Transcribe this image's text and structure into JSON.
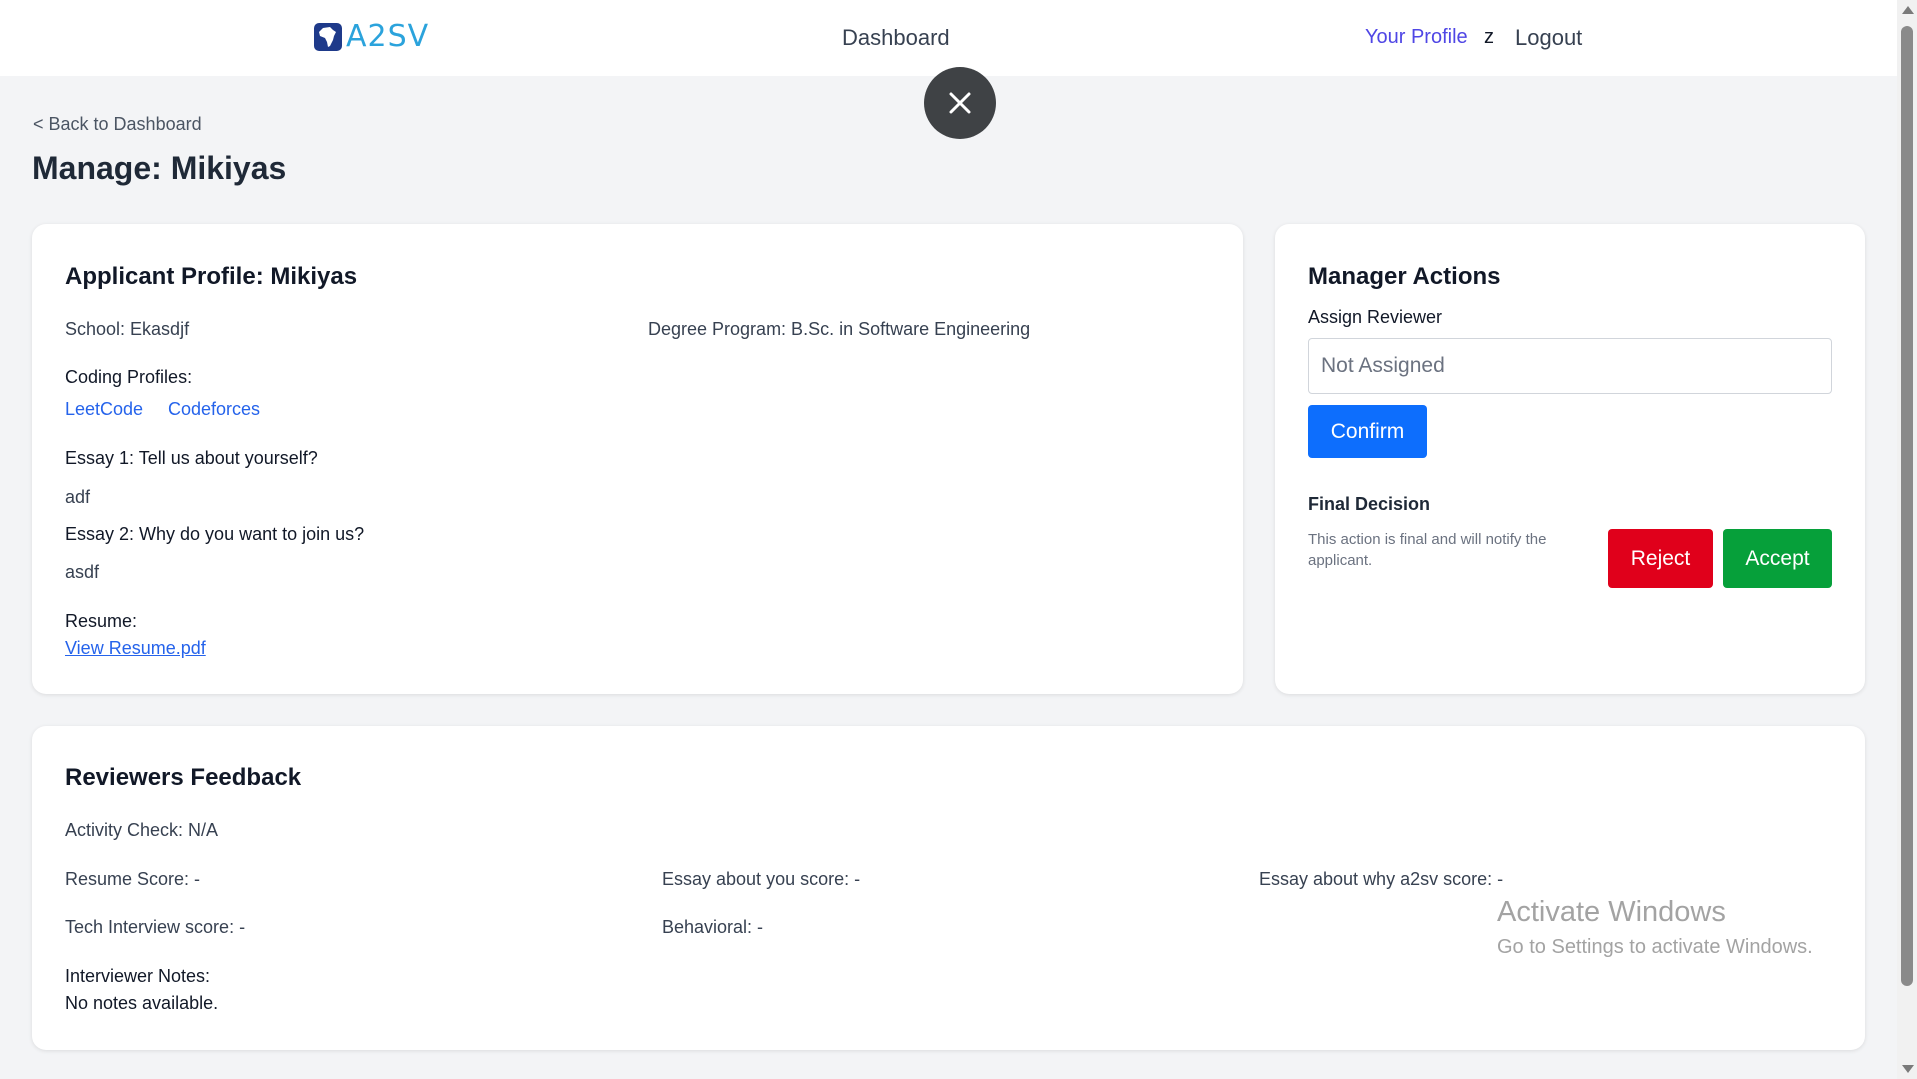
{
  "nav": {
    "logo_text": "A2SV",
    "dashboard": "Dashboard",
    "profile": "Your Profile",
    "user_initial": "z",
    "logout": "Logout"
  },
  "header": {
    "back_link": "< Back to Dashboard",
    "title": "Manage: Mikiyas"
  },
  "profile": {
    "title": "Applicant Profile: Mikiyas",
    "school": "School: Ekasdjf",
    "degree": "Degree Program: B.Sc. in Software Engineering",
    "coding_label": "Coding Profiles:",
    "coding_links": [
      "LeetCode",
      "Codeforces"
    ],
    "essay1_question": "Essay 1: Tell us about yourself?",
    "essay1_answer": "adf",
    "essay2_question": "Essay 2: Why do you want to join us?",
    "essay2_answer": "asdf",
    "resume_label": "Resume:",
    "resume_link": "View Resume.pdf"
  },
  "actions": {
    "title": "Manager Actions",
    "assign_label": "Assign Reviewer",
    "assign_placeholder": "Not Assigned",
    "confirm": "Confirm",
    "final_title": "Final Decision",
    "final_note": "This action is final and will notify the applicant.",
    "reject": "Reject",
    "accept": "Accept"
  },
  "feedback": {
    "title": "Reviewers Feedback",
    "activity_check": "Activity Check: N/A",
    "resume_score": "Resume Score: -",
    "essay_you_score": "Essay about you score: -",
    "essay_why_score": "Essay about why a2sv score: -",
    "tech_score": "Tech Interview score: -",
    "behavioral": "Behavioral: -",
    "notes_label": "Interviewer Notes:",
    "notes_value": "No notes available."
  },
  "watermark": {
    "title": "Activate Windows",
    "subtitle": "Go to Settings to activate Windows."
  },
  "colors": {
    "primary": "#0d6efd",
    "reject": "#e0001b",
    "accept": "#06a03a",
    "profile_link": "#4f46e5",
    "link": "#2563eb"
  }
}
